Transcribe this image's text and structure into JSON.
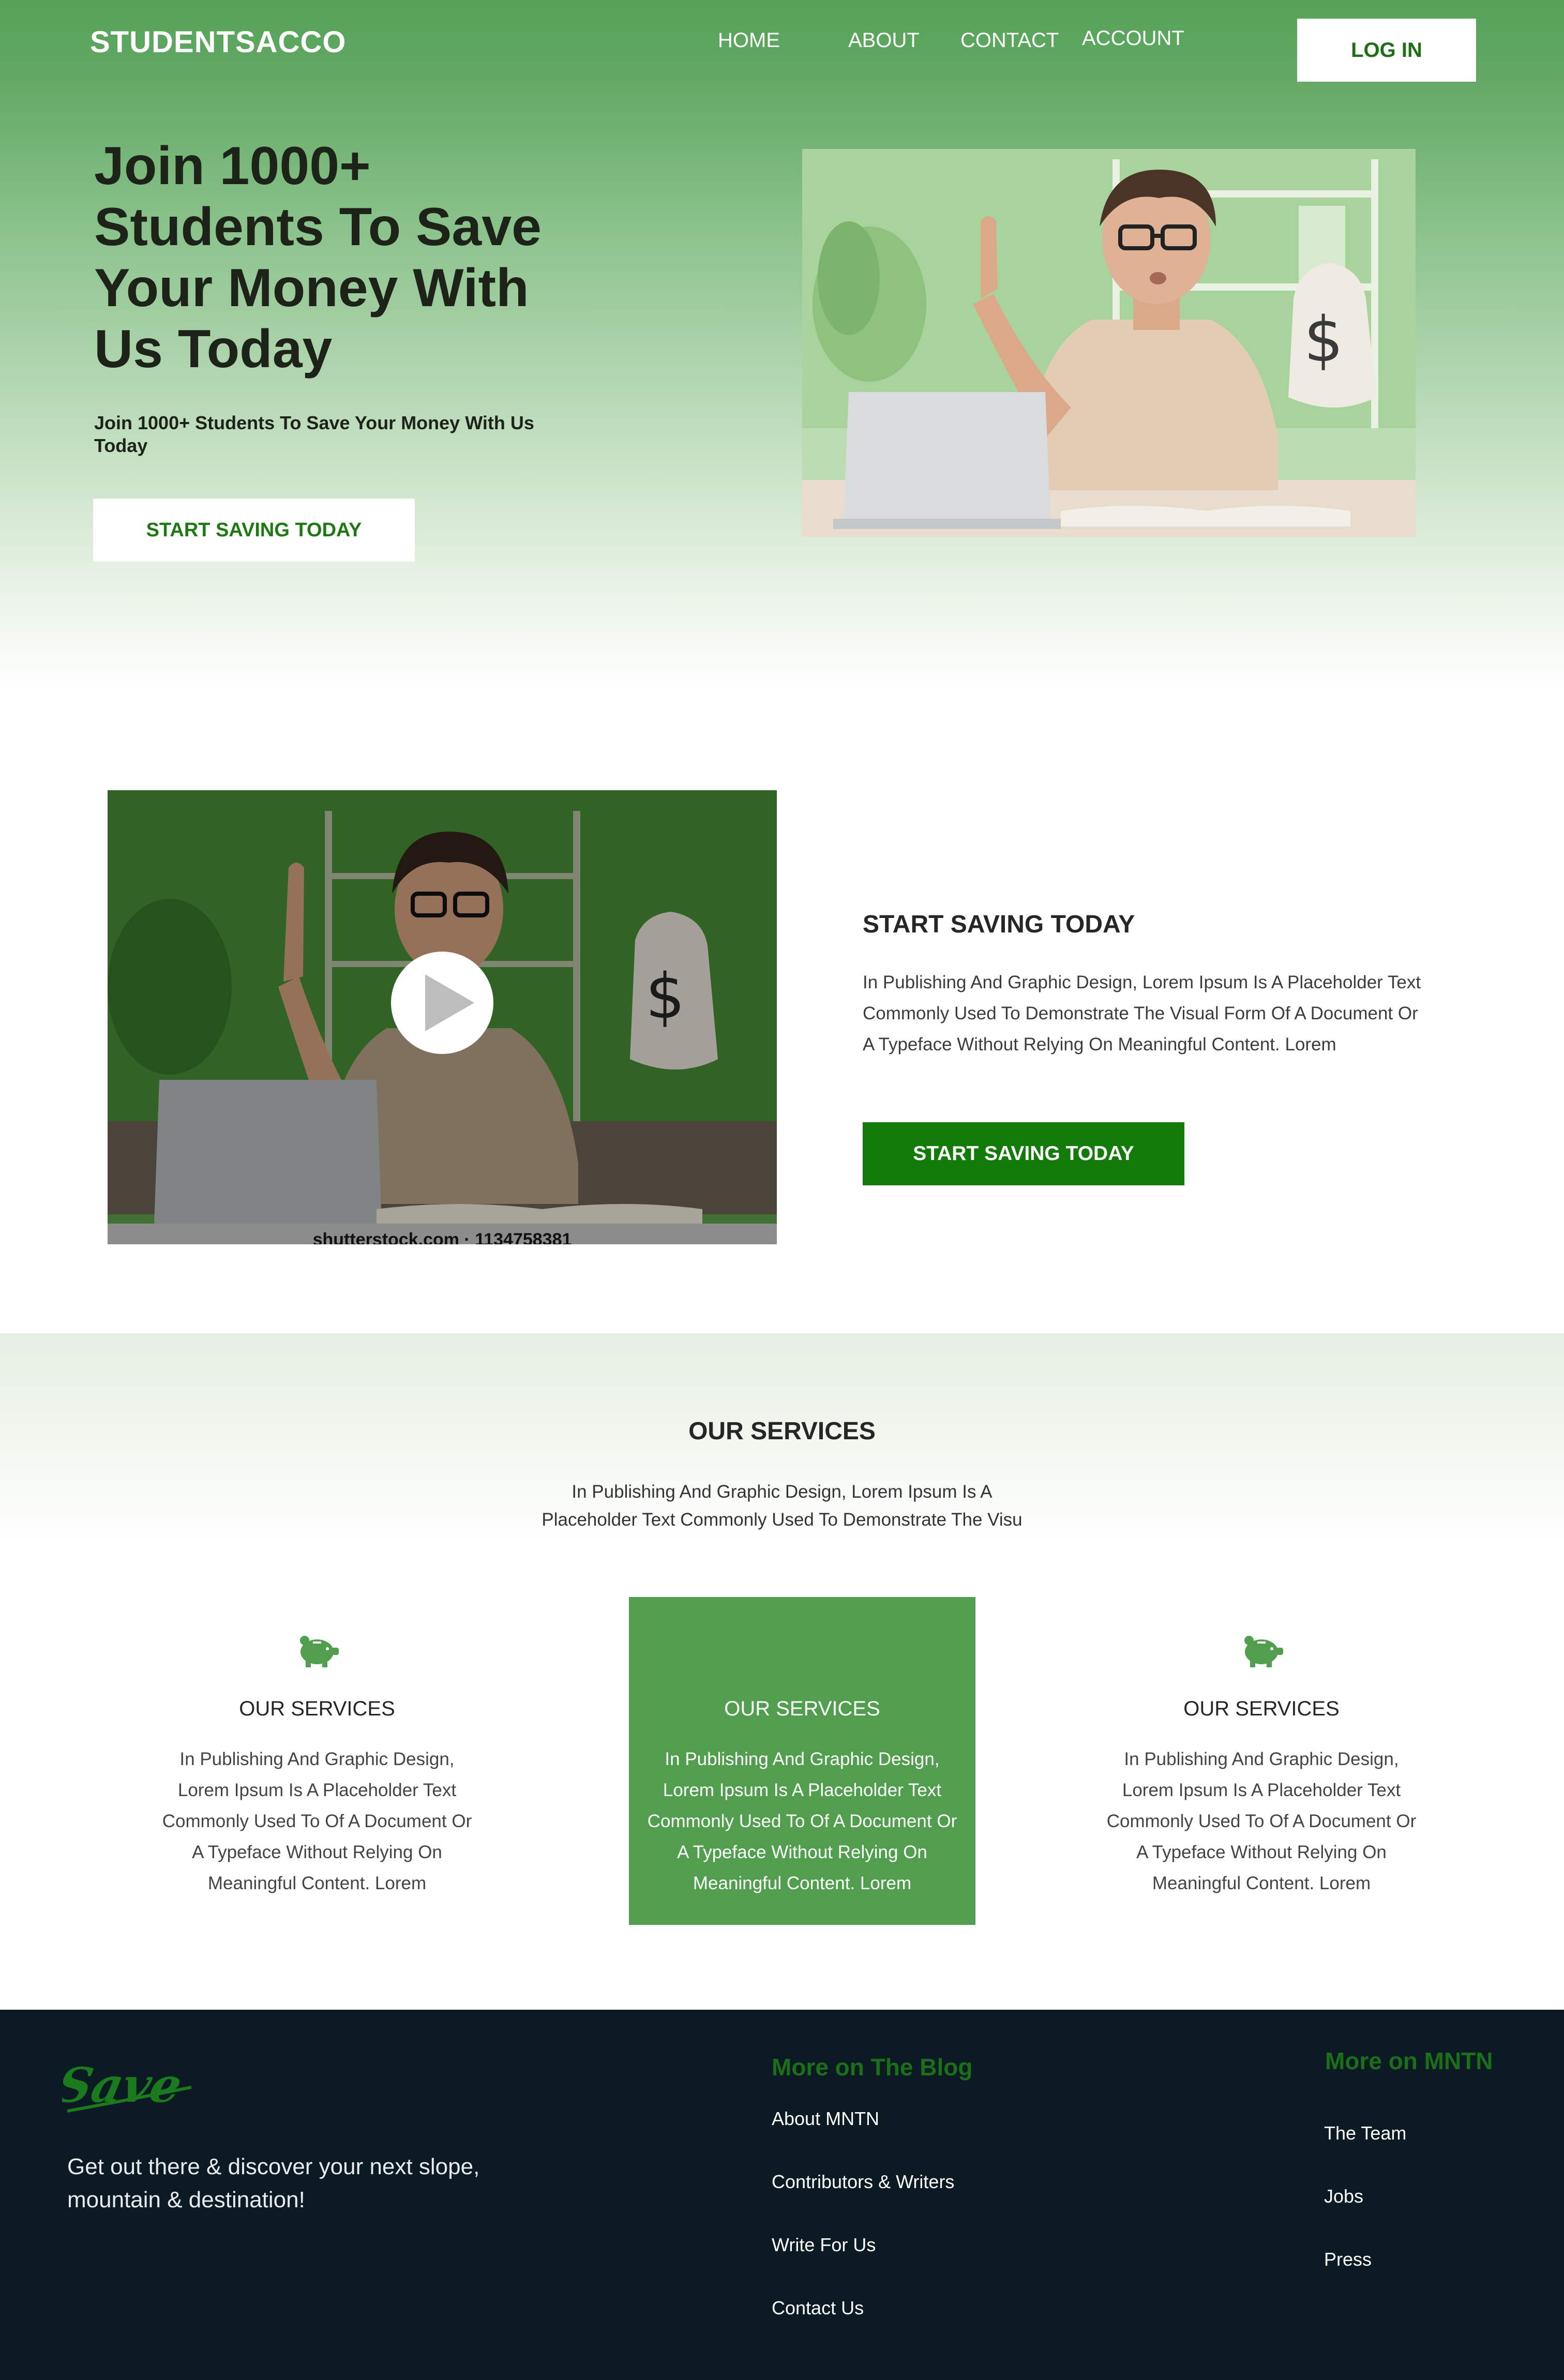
{
  "header": {
    "brand": "STUDENTSACCO",
    "nav": [
      "HOME",
      "ABOUT",
      "CONTACT",
      "ACCOUNT"
    ],
    "login_label": "LOG IN"
  },
  "hero": {
    "title": "Join 1000+ Students To Save Your Money With Us Today",
    "subtitle": "Join 1000+ Students To Save Your Money With Us Today",
    "cta_label": "START SAVING TODAY"
  },
  "feature": {
    "video_caption": "shutterstock.com · 1134758381",
    "title": "START SAVING TODAY",
    "text": "In Publishing And Graphic Design, Lorem Ipsum Is A Placeholder Text Commonly Used To Demonstrate The Visual Form Of A Document Or A Typeface Without Relying On Meaningful Content. Lorem",
    "cta_label": "START SAVING TODAY"
  },
  "services": {
    "title": "OUR SERVICES",
    "subtitle": "In Publishing And Graphic Design, Lorem Ipsum Is A Placeholder Text Commonly Used To Demonstrate The Visu",
    "cards": [
      {
        "icon": "piggy-bank-icon",
        "title": "OUR SERVICES",
        "text": "In Publishing And Graphic Design, Lorem Ipsum Is A Placeholder Text Commonly Used To Of A Document Or A Typeface Without Relying On Meaningful Content. Lorem"
      },
      {
        "icon": "piggy-bank-icon",
        "title": "OUR SERVICES",
        "text": "In Publishing And Graphic Design, Lorem Ipsum Is A Placeholder Text Commonly Used To Of A Document Or A Typeface Without Relying On Meaningful Content. Lorem"
      },
      {
        "icon": "piggy-bank-icon",
        "title": "OUR SERVICES",
        "text": "In Publishing And Graphic Design, Lorem Ipsum Is A Placeholder Text Commonly Used To Of A Document Or A Typeface Without Relying On Meaningful Content. Lorem"
      }
    ]
  },
  "footer": {
    "logo_text": "Save",
    "tagline": "Get out there & discover your next slope, mountain & destination!",
    "blog": {
      "heading": "More on The Blog",
      "links": [
        "About MNTN",
        "Contributors & Writers",
        "Write For Us",
        "Contact Us"
      ]
    },
    "mntn": {
      "heading": "More on MNTN",
      "links": [
        "The Team",
        "Jobs",
        "Press"
      ]
    }
  },
  "colors": {
    "brand_green": "#55a258",
    "accent_green": "#137b0a",
    "card_highlight": "#509e4e",
    "footer_bg": "#0c1a23",
    "footer_heading": "#1b6e1a"
  }
}
